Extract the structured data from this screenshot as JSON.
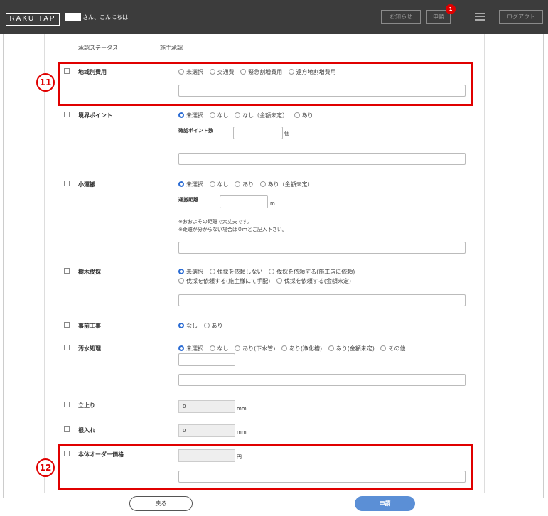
{
  "header": {
    "logo": "RAKU TAP",
    "greeting": "さん、こんにちは",
    "notice_button": "お知らせ",
    "apply_button": "申請",
    "badge_count": "1",
    "logout_button": "ログアウト"
  },
  "status": {
    "label": "承認ステータス",
    "value": "施主承認"
  },
  "sections": {
    "regional": {
      "label": "地域別費用",
      "options": [
        "未選択",
        "交通費",
        "緊急割増費用",
        "遠方地割増費用"
      ]
    },
    "boundary": {
      "label": "境界ポイント",
      "options": [
        "未選択",
        "なし",
        "なし（金額未定）",
        "あり"
      ],
      "sublabel": "確認ポイント数",
      "unit": "個"
    },
    "short_path": {
      "label": "小運搬",
      "options": [
        "未選択",
        "なし",
        "あり",
        "あり（金額未定）"
      ],
      "sublabel": "運搬距離",
      "unit": "m",
      "note1": "※おおよその距離で大丈夫です。",
      "note2": "※距離が分からない場合は０ｍとご記入下さい。"
    },
    "tree": {
      "label": "樹木伐採",
      "options_row1": [
        "未選択",
        "伐採を依頼しない",
        "伐採を依頼する(施工店に依頼)"
      ],
      "options_row2": [
        "伐採を依頼する(施主様にて手配)",
        "伐採を依頼する(金額未定)"
      ]
    },
    "pre_work": {
      "label": "事前工事",
      "options": [
        "なし",
        "あり"
      ]
    },
    "sewage": {
      "label": "汚水処理",
      "options": [
        "未選択",
        "なし",
        "あり(下水管)",
        "あり(浄化槽)",
        "あり(金額未定)",
        "その他"
      ]
    },
    "rise": {
      "label": "立上り",
      "value": "0",
      "unit": "mm"
    },
    "embed": {
      "label": "根入れ",
      "value": "0",
      "unit": "mm"
    },
    "body_price": {
      "label": "本体オーダー価格",
      "unit": "円"
    }
  },
  "annotations": {
    "num11": "11",
    "num12": "12"
  },
  "footer": {
    "back": "戻る",
    "submit": "申請"
  },
  "colors": {
    "header_bg": "#3c3c3c",
    "highlight_red": "#e00000",
    "radio_blue": "#2b6cd4",
    "submit_blue": "#5b8fd6"
  }
}
